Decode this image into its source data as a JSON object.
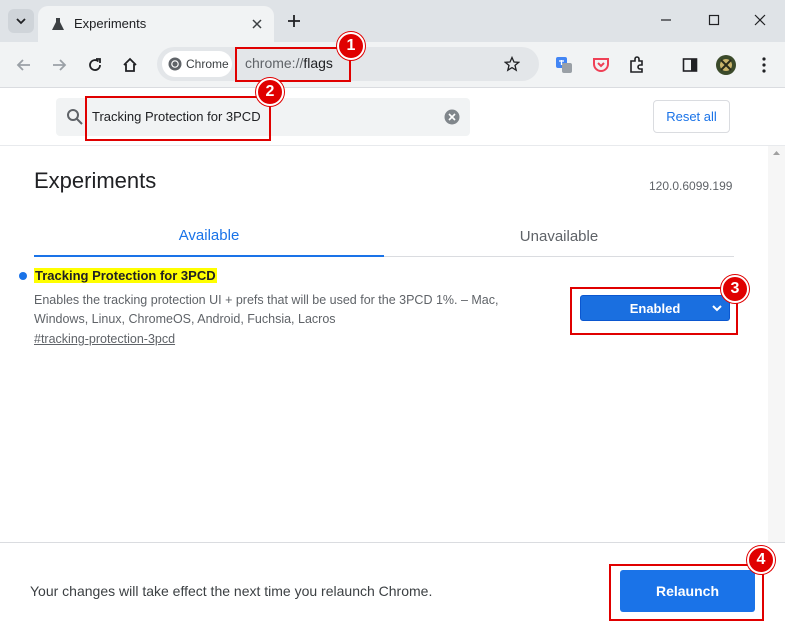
{
  "browser": {
    "tab_title": "Experiments",
    "chip_label": "Chrome",
    "url_prefix": "chrome://",
    "url_path": "flags"
  },
  "search": {
    "value": "Tracking Protection for 3PCD",
    "reset_label": "Reset all"
  },
  "page": {
    "title": "Experiments",
    "version": "120.0.6099.199",
    "tabs": [
      {
        "label": "Available"
      },
      {
        "label": "Unavailable"
      }
    ]
  },
  "flag": {
    "name": "Tracking Protection for 3PCD",
    "description": "Enables the tracking protection UI + prefs that will be used for the 3PCD 1%. – Mac, Windows, Linux, ChromeOS, Android, Fuchsia, Lacros",
    "link": "#tracking-protection-3pcd",
    "selected": "Enabled"
  },
  "footer": {
    "message": "Your changes will take effect the next time you relaunch Chrome.",
    "relaunch_label": "Relaunch"
  },
  "annotations": [
    {
      "number": "1"
    },
    {
      "number": "2"
    },
    {
      "number": "3"
    },
    {
      "number": "4"
    }
  ],
  "colors": {
    "accent": "#1a73e8",
    "highlight": "#ffff00",
    "callout": "#e00000"
  }
}
